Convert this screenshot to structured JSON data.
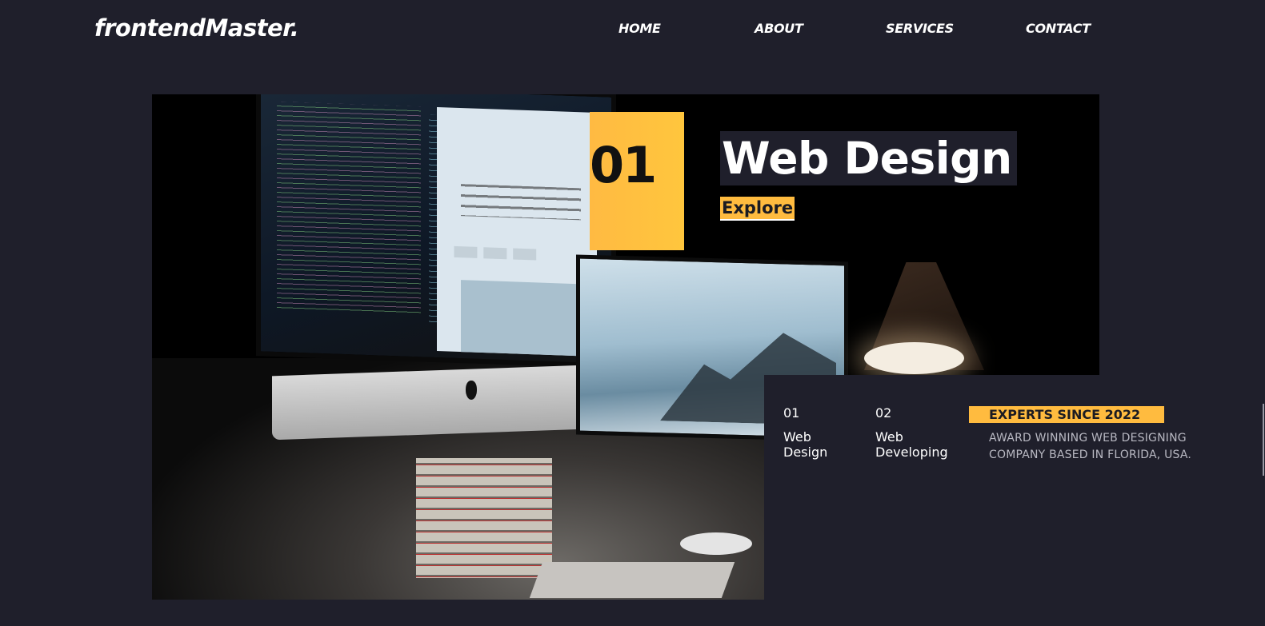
{
  "header": {
    "logo": "frontendMaster.",
    "nav": [
      "HOME",
      "ABOUT",
      "SERVICES",
      "CONTACT"
    ]
  },
  "hero": {
    "number": "01",
    "title": "Web Design",
    "cta": "Explore"
  },
  "services": [
    {
      "number": "01",
      "label_line1": "Web",
      "label_line2": "Design"
    },
    {
      "number": "02",
      "label_line1": "Web",
      "label_line2": "Developing"
    }
  ],
  "about": {
    "badge": "EXPERTS SINCE 2022",
    "description": "AWARD WINNING WEB DESIGNING COMPANY BASED IN FLORIDA, USA."
  },
  "colors": {
    "background": "#1f1f2b",
    "accent": "#ffbb3f"
  }
}
